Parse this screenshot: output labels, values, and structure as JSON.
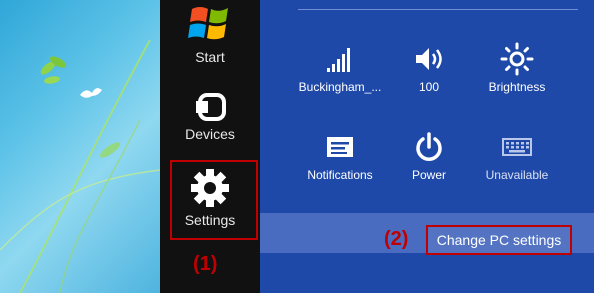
{
  "charms": {
    "start": {
      "label": "Start",
      "icon": "windows-logo-icon"
    },
    "devices": {
      "label": "Devices",
      "icon": "devices-icon"
    },
    "settings": {
      "label": "Settings",
      "icon": "gear-icon"
    }
  },
  "annotations": {
    "one": "(1)",
    "two": "(2)"
  },
  "settings_panel": {
    "tiles": [
      {
        "label": "Buckingham_...",
        "icon": "wifi-signal-icon"
      },
      {
        "label": "100",
        "icon": "volume-icon"
      },
      {
        "label": "Brightness",
        "icon": "brightness-icon"
      },
      {
        "label": "Notifications",
        "icon": "notifications-icon"
      },
      {
        "label": "Power",
        "icon": "power-icon"
      },
      {
        "label": "Unavailable",
        "icon": "keyboard-icon"
      }
    ],
    "change_pc_settings": "Change PC settings"
  },
  "colors": {
    "panel": "#1f49a8",
    "charms": "#111111",
    "annotation_red": "#c00000"
  }
}
